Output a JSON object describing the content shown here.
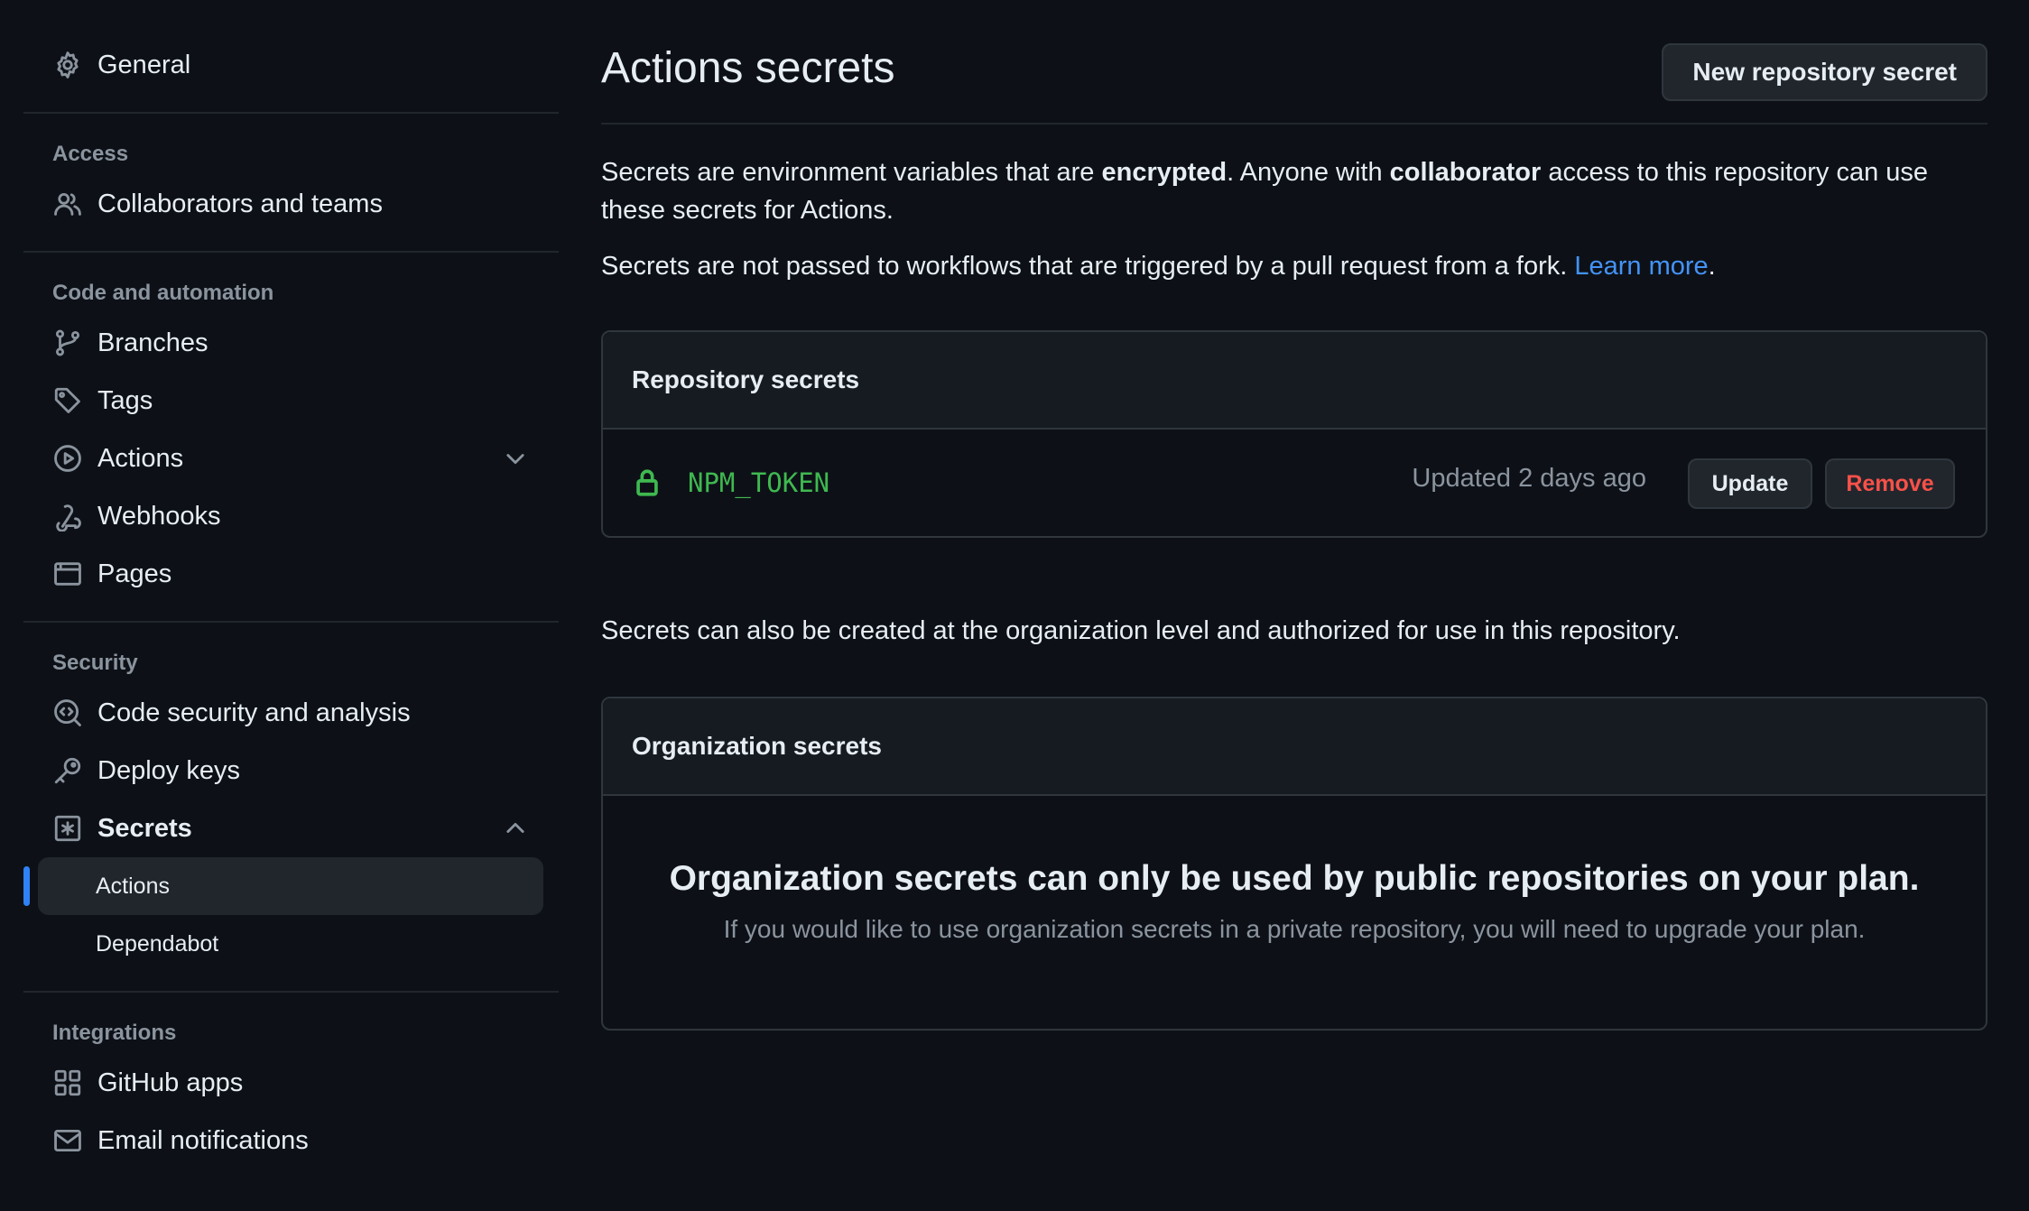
{
  "sidebar": {
    "general": "General",
    "access_heading": "Access",
    "collaborators": "Collaborators and teams",
    "code_heading": "Code and automation",
    "branches": "Branches",
    "tags": "Tags",
    "actions": "Actions",
    "webhooks": "Webhooks",
    "pages": "Pages",
    "security_heading": "Security",
    "code_security": "Code security and analysis",
    "deploy_keys": "Deploy keys",
    "secrets": "Secrets",
    "secrets_sub": [
      "Actions",
      "Dependabot"
    ],
    "integrations_heading": "Integrations",
    "github_apps": "GitHub apps",
    "email_notifications": "Email notifications"
  },
  "main": {
    "title": "Actions secrets",
    "new_secret_button": "New repository secret",
    "intro": {
      "part1": "Secrets are environment variables that are ",
      "bold1": "encrypted",
      "part2": ". Anyone with ",
      "bold2": "collaborator",
      "part3": " access to this repository can use these secrets for Actions."
    },
    "fork_note": {
      "text": "Secrets are not passed to workflows that are triggered by a pull request from a fork. ",
      "link": "Learn more",
      "end": "."
    },
    "repo_secrets": {
      "heading": "Repository secrets",
      "items": [
        {
          "name": "NPM_TOKEN",
          "updated": "Updated 2 days ago",
          "update_label": "Update",
          "remove_label": "Remove"
        }
      ]
    },
    "org_note": "Secrets can also be created at the organization level and authorized for use in this repository.",
    "org_secrets": {
      "heading": "Organization secrets",
      "title": "Organization secrets can only be used by public repositories on your plan.",
      "subtitle": "If you would like to use organization secrets in a private repository, you will need to upgrade your plan."
    }
  },
  "colors": {
    "background": "#0d1117",
    "accent": "#2f81f7",
    "link": "#4493f8",
    "success": "#3fb950",
    "danger": "#f85149"
  },
  "icons": [
    "gear-icon",
    "people-icon",
    "branch-icon",
    "tag-icon",
    "play-icon",
    "webhook-icon",
    "browser-icon",
    "codescan-icon",
    "key-icon",
    "asterisk-box-icon",
    "apps-icon",
    "mail-icon",
    "lock-icon",
    "chevron-down-icon",
    "chevron-up-icon"
  ]
}
